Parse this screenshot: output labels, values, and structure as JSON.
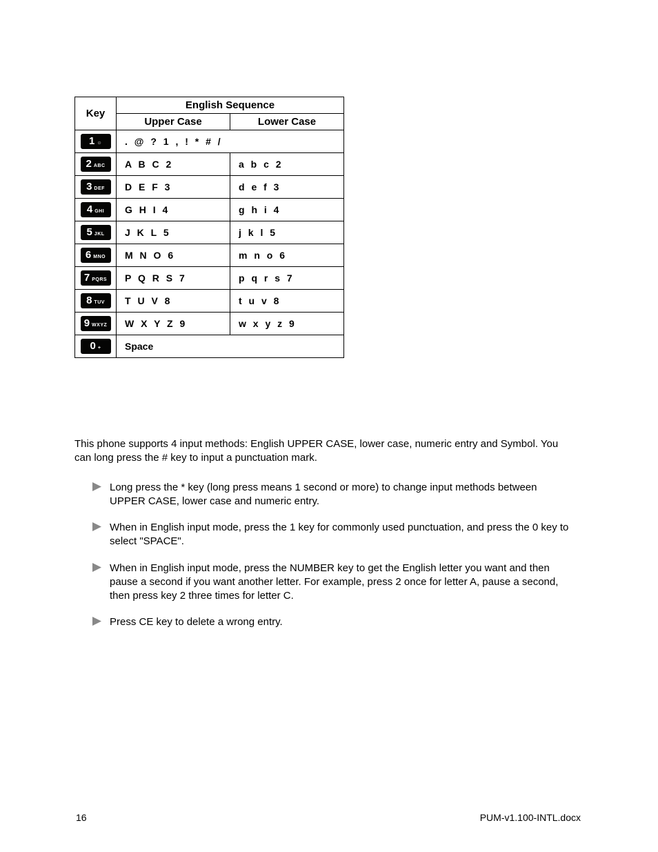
{
  "table": {
    "header_key": "Key",
    "header_seq": "English Sequence",
    "header_upper": "Upper Case",
    "header_lower": "Lower Case",
    "rows": [
      {
        "digit": "1",
        "sub": "☺",
        "upper": ". @ ? 1 , ! * # /",
        "lower": ""
      },
      {
        "digit": "2",
        "sub": "ABC",
        "upper": "A B C 2",
        "lower": "a b c 2"
      },
      {
        "digit": "3",
        "sub": "DEF",
        "upper": "D E F 3",
        "lower": "d e f 3"
      },
      {
        "digit": "4",
        "sub": "GHI",
        "upper": "G H I 4",
        "lower": "g h i 4"
      },
      {
        "digit": "5",
        "sub": "JKL",
        "upper": "J K L 5",
        "lower": "j k l 5"
      },
      {
        "digit": "6",
        "sub": "MNO",
        "upper": "M N O 6",
        "lower": "m n o 6"
      },
      {
        "digit": "7",
        "sub": "PQRS",
        "upper": "P Q R S 7",
        "lower": "p q r s 7"
      },
      {
        "digit": "8",
        "sub": "TUV",
        "upper": "T U V 8",
        "lower": "t u v 8"
      },
      {
        "digit": "9",
        "sub": "WXYZ",
        "upper": "W X Y Z 9",
        "lower": "w x y z 9"
      },
      {
        "digit": "0",
        "sub": "+",
        "upper": "Space",
        "lower": ""
      }
    ]
  },
  "intro": "This phone supports 4 input methods: English UPPER CASE, lower case, numeric entry and Symbol. You can long press the # key to input a punctuation mark.",
  "bullets": [
    "Long press the * key (long press means 1 second or more) to change input methods between UPPER CASE, lower case and numeric entry.",
    "When in English input mode, press the 1 key for commonly used punctuation, and press the 0 key to select \"SPACE\".",
    "When in English input mode, press the NUMBER key to get the English letter you want and then pause a second if you want another letter. For example, press 2 once for letter A, pause a second, then press key 2 three times for letter C.",
    "Press CE key to delete a wrong entry."
  ],
  "footer": {
    "page": "16",
    "file": "PUM-v1.100-INTL.docx"
  }
}
